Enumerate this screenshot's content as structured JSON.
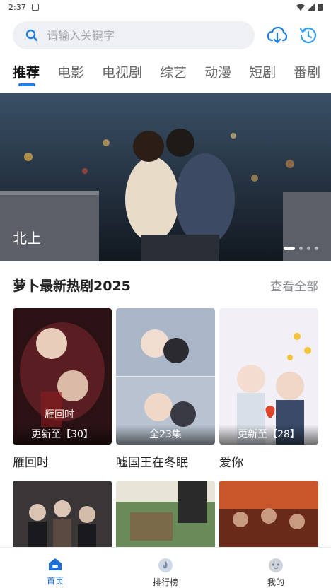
{
  "status_bar": {
    "time": "2:37"
  },
  "search": {
    "placeholder": "请输入关键字"
  },
  "tabs": [
    {
      "label": "推荐",
      "active": true
    },
    {
      "label": "电影"
    },
    {
      "label": "电视剧"
    },
    {
      "label": "综艺"
    },
    {
      "label": "动漫"
    },
    {
      "label": "短剧"
    },
    {
      "label": "番剧"
    }
  ],
  "banner": {
    "title": "北上",
    "slide_count": 4,
    "active_slide": 1
  },
  "section": {
    "title": "萝卜最新热剧2025",
    "see_all": "查看全部",
    "items": [
      {
        "title": "雁回时",
        "badge": "更新至【30】"
      },
      {
        "title": "嘘国王在冬眠",
        "badge": "全23集"
      },
      {
        "title": "爱你",
        "badge": "更新至【28】"
      }
    ]
  },
  "nav": {
    "home": "首页",
    "ranking": "排行榜",
    "mine": "我的"
  },
  "colors": {
    "accent": "#2a7de1",
    "tab_active": "#111111",
    "tab_inactive": "#666666"
  }
}
